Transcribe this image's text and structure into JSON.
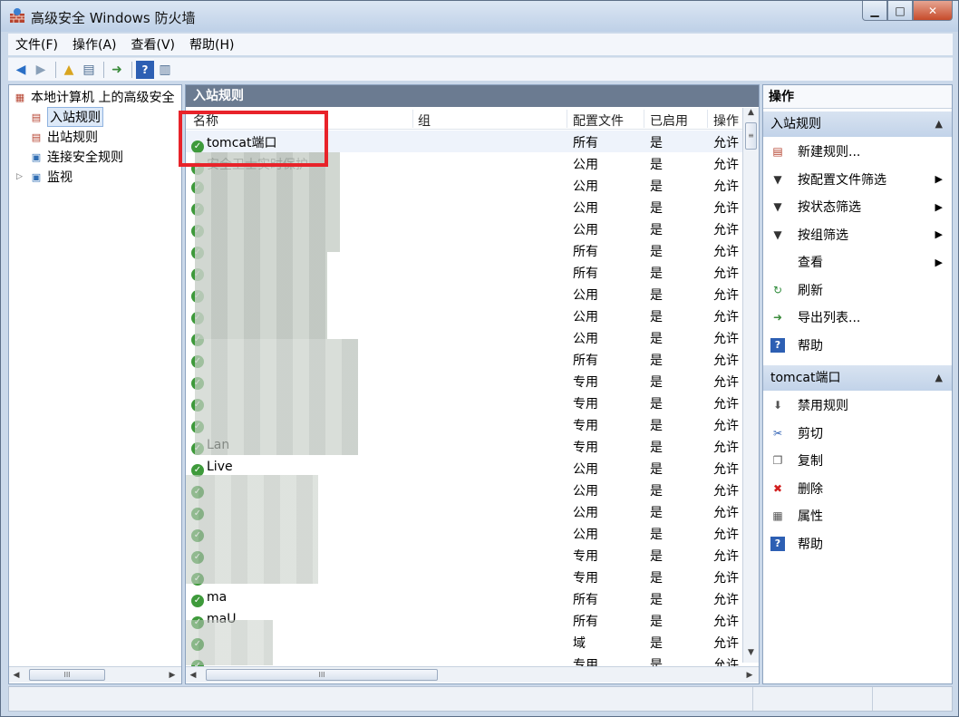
{
  "window": {
    "title": "高级安全 Windows 防火墙",
    "controls": {
      "minimize": "▁",
      "maximize": "□",
      "close": "✕"
    }
  },
  "menu": [
    "文件(F)",
    "操作(A)",
    "查看(V)",
    "帮助(H)"
  ],
  "tree": {
    "root": "本地计算机 上的高级安全",
    "items": [
      {
        "label": "入站规则",
        "selected": true
      },
      {
        "label": "出站规则"
      },
      {
        "label": "连接安全规则"
      },
      {
        "label": "监视",
        "expander": "▷"
      }
    ]
  },
  "center": {
    "header": "入站规则",
    "columns": [
      "名称",
      "组",
      "配置文件",
      "已启用",
      "操作"
    ],
    "rows": [
      {
        "name": "tomcat端口",
        "profile": "所有",
        "enabled": "是",
        "action": "允许"
      },
      {
        "name": "安全卫士实时保护",
        "profile": "公用",
        "enabled": "是",
        "action": "允许"
      },
      {
        "name": "",
        "profile": "公用",
        "enabled": "是",
        "action": "允许"
      },
      {
        "name": "",
        "profile": "公用",
        "enabled": "是",
        "action": "允许"
      },
      {
        "name": "",
        "profile": "公用",
        "enabled": "是",
        "action": "允许"
      },
      {
        "name": "",
        "profile": "所有",
        "enabled": "是",
        "action": "允许"
      },
      {
        "name": "",
        "profile": "所有",
        "enabled": "是",
        "action": "允许"
      },
      {
        "name": "",
        "profile": "公用",
        "enabled": "是",
        "action": "允许"
      },
      {
        "name": "",
        "profile": "公用",
        "enabled": "是",
        "action": "允许"
      },
      {
        "name": "",
        "profile": "公用",
        "enabled": "是",
        "action": "允许"
      },
      {
        "name": "",
        "profile": "所有",
        "enabled": "是",
        "action": "允许"
      },
      {
        "name": "",
        "profile": "专用",
        "enabled": "是",
        "action": "允许"
      },
      {
        "name": "",
        "profile": "专用",
        "enabled": "是",
        "action": "允许"
      },
      {
        "name": "",
        "profile": "专用",
        "enabled": "是",
        "action": "允许"
      },
      {
        "name": "Lan",
        "profile": "专用",
        "enabled": "是",
        "action": "允许"
      },
      {
        "name": "Live",
        "profile": "公用",
        "enabled": "是",
        "action": "允许"
      },
      {
        "name": "",
        "profile": "公用",
        "enabled": "是",
        "action": "允许"
      },
      {
        "name": "",
        "profile": "公用",
        "enabled": "是",
        "action": "允许"
      },
      {
        "name": "",
        "profile": "公用",
        "enabled": "是",
        "action": "允许"
      },
      {
        "name": "",
        "profile": "专用",
        "enabled": "是",
        "action": "允许"
      },
      {
        "name": "",
        "profile": "专用",
        "enabled": "是",
        "action": "允许"
      },
      {
        "name": "ma",
        "profile": "所有",
        "enabled": "是",
        "action": "允许"
      },
      {
        "name": "maU",
        "profile": "所有",
        "enabled": "是",
        "action": "允许"
      },
      {
        "name": "",
        "profile": "域",
        "enabled": "是",
        "action": "允许"
      },
      {
        "name": "",
        "profile": "专用",
        "enabled": "是",
        "action": "允许"
      }
    ]
  },
  "actions": {
    "title": "操作",
    "sections": [
      {
        "title": "入站规则",
        "items": [
          {
            "label": "新建规则...",
            "icon": "new-rule-icon"
          },
          {
            "label": "按配置文件筛选",
            "icon": "filter-icon",
            "sub": true
          },
          {
            "label": "按状态筛选",
            "icon": "filter-icon",
            "sub": true
          },
          {
            "label": "按组筛选",
            "icon": "filter-icon",
            "sub": true
          },
          {
            "label": "查看",
            "icon": "",
            "sub": true
          },
          {
            "label": "刷新",
            "icon": "refresh-icon"
          },
          {
            "label": "导出列表...",
            "icon": "export-icon"
          },
          {
            "label": "帮助",
            "icon": "help-icon"
          }
        ]
      },
      {
        "title": "tomcat端口",
        "items": [
          {
            "label": "禁用规则",
            "icon": "disable-icon"
          },
          {
            "label": "剪切",
            "icon": "cut-icon"
          },
          {
            "label": "复制",
            "icon": "copy-icon"
          },
          {
            "label": "删除",
            "icon": "delete-icon"
          },
          {
            "label": "属性",
            "icon": "properties-icon"
          },
          {
            "label": "帮助",
            "icon": "help-icon"
          }
        ]
      }
    ]
  },
  "colors": {
    "header_bg": "#6b7b91",
    "highlight": "#e8232a",
    "section_bg": "#c9d8ec"
  }
}
